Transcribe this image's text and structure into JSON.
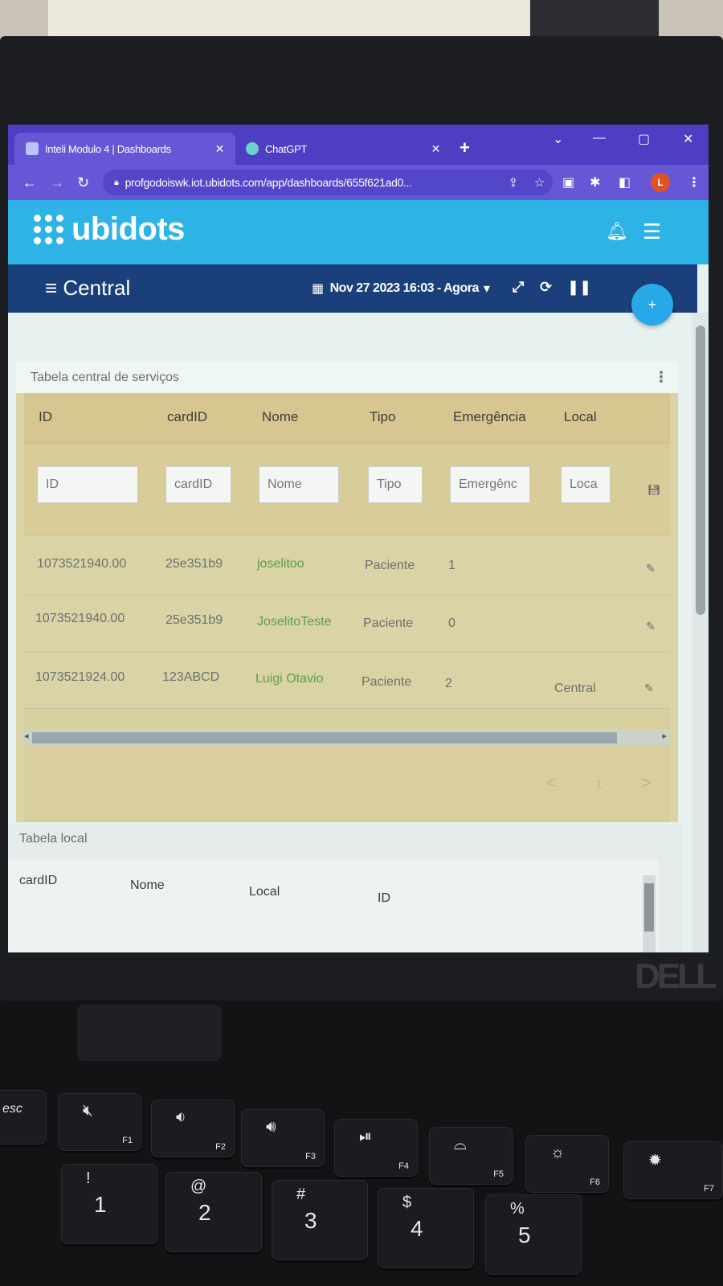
{
  "browser": {
    "tabs": [
      {
        "label": "Inteli Modulo 4 | Dashboards",
        "active": true
      },
      {
        "label": "ChatGPT",
        "active": false
      }
    ],
    "new_tab": "+",
    "url": "profgodoiswk.iot.ubidots.com/app/dashboards/655f621ad0...",
    "profile_initial": "L"
  },
  "app": {
    "logo_text": "ubidots",
    "dashboard_title": "Central",
    "date_range": "Nov 27 2023 16:03 - Agora",
    "fab_label": "+"
  },
  "widget_services": {
    "title": "Tabela central de serviços",
    "columns": [
      "ID",
      "cardID",
      "Nome",
      "Tipo",
      "Emergência",
      "Local"
    ],
    "filters": [
      "ID",
      "cardID",
      "Nome",
      "Tipo",
      "Emergênc",
      "Loca"
    ],
    "rows": [
      {
        "id": "1073521940.00",
        "card_id": "25e351b9",
        "nome": "joselitoo",
        "tipo": "Paciente",
        "emergencia": "1",
        "local": ""
      },
      {
        "id": "1073521940.00",
        "card_id": "25e351b9",
        "nome": "JoselitoTeste",
        "tipo": "Paciente",
        "emergencia": "0",
        "local": ""
      },
      {
        "id": "1073521924.00",
        "card_id": "123ABCD",
        "nome": "Luigi Otavio",
        "tipo": "Paciente",
        "emergencia": "2",
        "local": "Central"
      }
    ],
    "pagination": {
      "prev": "<",
      "page": "1",
      "next": ">"
    }
  },
  "widget_local": {
    "title": "Tabela local",
    "columns": [
      "cardID",
      "Nome",
      "Local",
      "ID"
    ]
  },
  "keyboard": {
    "esc": "esc",
    "fkeys": [
      "F1",
      "F2",
      "F3",
      "F4",
      "F5",
      "F6",
      "F7"
    ],
    "num_symbols": [
      "!",
      "@",
      "#",
      "$",
      "%"
    ],
    "num_digits": [
      "1",
      "2",
      "3",
      "4",
      "5"
    ],
    "brand": "DELL"
  },
  "colors": {
    "tab_bar": "#4d3ec4",
    "ubidots_blue": "#2db3e6",
    "dash_navy": "#1a3f7a",
    "table_bg": "#d9d3a6",
    "name_link": "#5aa04a"
  }
}
